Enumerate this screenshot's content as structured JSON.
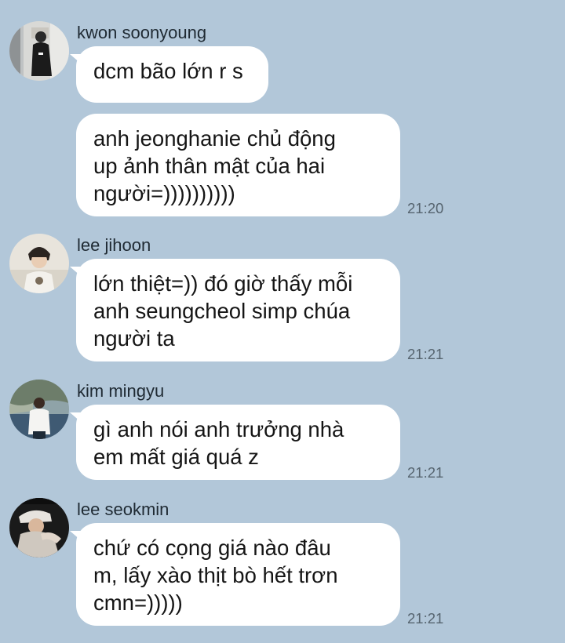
{
  "chat": {
    "groups": [
      {
        "sender": "kwon soonyoung",
        "avatar_icon": "profile-photo-icon",
        "messages": [
          {
            "lines": [
              "dcm bão lớn r s"
            ]
          },
          {
            "lines": [
              "anh jeonghanie chủ động",
              "up ảnh thân mật của hai",
              "người=))))))))))"
            ],
            "time": "21:20"
          }
        ]
      },
      {
        "sender": "lee jihoon",
        "avatar_icon": "profile-photo-icon",
        "messages": [
          {
            "lines": [
              "lớn thiệt=)) đó giờ thấy mỗi",
              "anh seungcheol simp chúa",
              "người ta"
            ],
            "time": "21:21"
          }
        ]
      },
      {
        "sender": "kim mingyu",
        "avatar_icon": "profile-photo-icon",
        "messages": [
          {
            "lines": [
              "gì anh nói anh trưởng nhà",
              "em mất giá quá z"
            ],
            "time": "21:21"
          }
        ]
      },
      {
        "sender": "lee seokmin",
        "avatar_icon": "profile-photo-icon",
        "messages": [
          {
            "lines": [
              "chứ có cọng giá nào đâu",
              "m, lấy xào thịt bò hết trơn",
              "cmn=)))))"
            ],
            "time": "21:21"
          }
        ]
      }
    ]
  },
  "colors": {
    "background": "#b2c7d9",
    "bubble": "#ffffff",
    "time_text": "#56646f"
  }
}
